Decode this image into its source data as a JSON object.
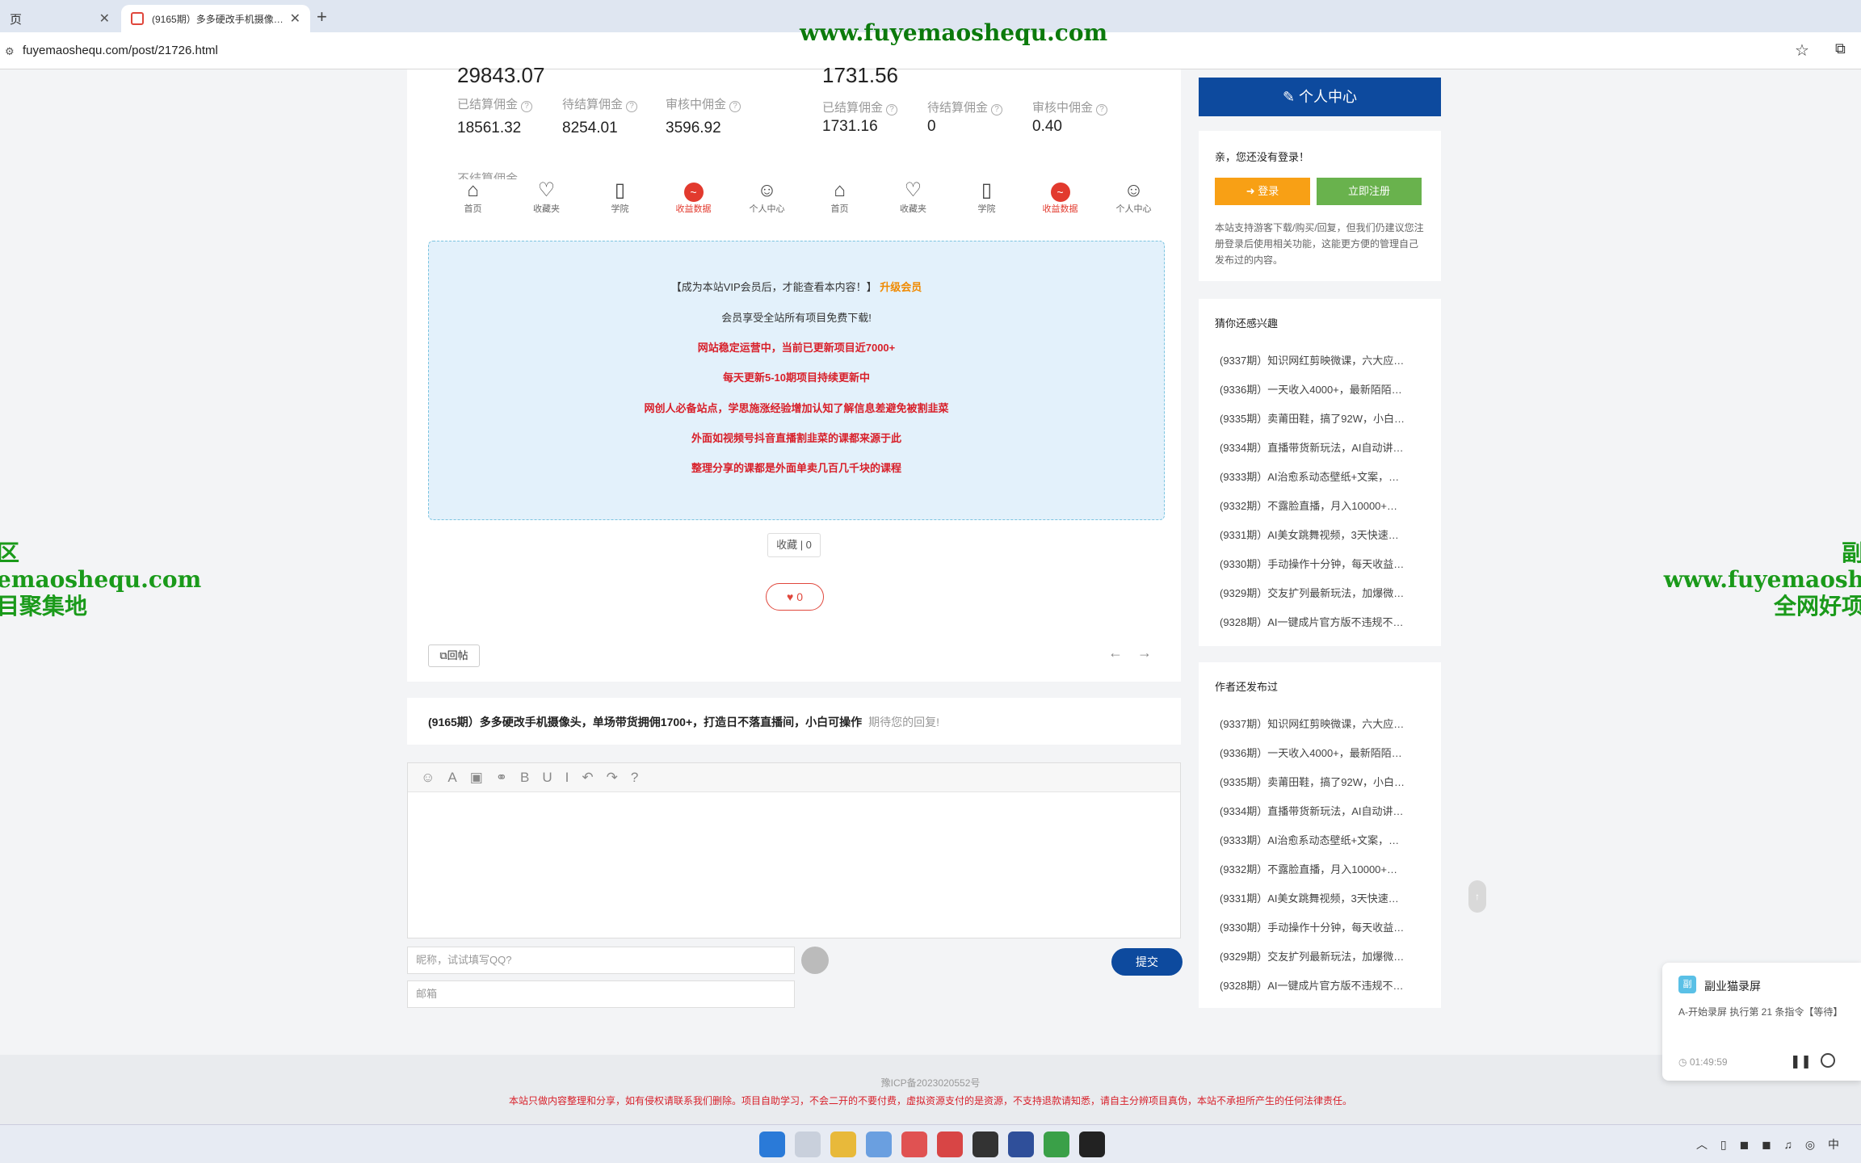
{
  "browser": {
    "tab1_title": "页",
    "tab2_title": "(9165期）多多硬改手机摄像…",
    "url": "fuyemaoshequ.com/post/21726.html"
  },
  "watermark": {
    "top": "www.fuyemaoshequ.com",
    "left": "区\nemaoshequ.com\n目聚集地",
    "right": "副\nwww.fuyemaosh\n全网好项"
  },
  "stats_left": {
    "big": "29843.07",
    "items": [
      {
        "label": "已结算佣金",
        "value": "18561.32"
      },
      {
        "label": "待结算佣金",
        "value": "8254.01"
      },
      {
        "label": "审核中佣金",
        "value": "3596.92"
      }
    ],
    "extra_label": "不结算佣金"
  },
  "stats_right": {
    "big": "1731.56",
    "items": [
      {
        "label": "已结算佣金",
        "value": "1731.16"
      },
      {
        "label": "待结算佣金",
        "value": "0"
      },
      {
        "label": "审核中佣金",
        "value": "0.40"
      }
    ]
  },
  "nav": [
    "首页",
    "收藏夹",
    "学院",
    "收益数据",
    "个人中心"
  ],
  "vip": {
    "line0_prefix": "【成为本站VIP会员后，才能查看本内容！】",
    "line0_link": "升级会员",
    "line1": "会员享受全站所有项目免费下载!",
    "line2": "网站稳定运营中，当前已更新项目近7000+",
    "line3": "每天更新5-10期项目持续更新中",
    "line4": "网创人必备站点，学思施涨经验增加认知了解信息差避免被割韭菜",
    "line5": "外面如视频号抖音直播割韭菜的课都来源于此",
    "line6": "整理分享的课都是外面单卖几百几千块的课程"
  },
  "actions": {
    "collect": "收藏 | 0",
    "like": "0",
    "reply": "回帖"
  },
  "comment": {
    "post_title": "(9165期）多多硬改手机摄像头，单场带货拥佣1700+，打造日不落直播间，小白可操作",
    "hint": "期待您的回复!",
    "nick_placeholder": "昵称，试试填写QQ?",
    "mail_placeholder": "邮箱",
    "submit": "提交"
  },
  "sidebar": {
    "user_center": "个人中心",
    "login_title": "亲，您还没有登录！",
    "login_btn": "登录",
    "register_btn": "立即注册",
    "login_desc": "本站支持游客下载/购买/回复，但我们仍建议您注册登录后使用相关功能，这能更方便的管理自己发布过的内容。",
    "guess_title": "猜你还感兴趣",
    "author_title": "作者还发布过",
    "items": [
      "(9337期）知识网红剪映微课，六大应…",
      "(9336期）一天收入4000+，最新陌陌…",
      "(9335期）卖莆田鞋，搞了92W，小白…",
      "(9334期）直播带货新玩法，AI自动讲…",
      "(9333期）AI治愈系动态壁纸+文案，…",
      "(9332期）不露脸直播，月入10000+…",
      "(9331期）AI美女跳舞视频，3天快速…",
      "(9330期）手动操作十分钟，每天收益…",
      "(9329期）交友扩列最新玩法，加爆微…",
      "(9328期）AI一键成片官方版不违规不…"
    ]
  },
  "footer": {
    "icp": "豫ICP备2023020552号",
    "disclaimer": "本站只做内容整理和分享，如有侵权请联系我们删除。项目自助学习，不会二开的不要付费，虚拟资源支付的是资源，不支持退款请知悉，请自主分辨项目真伪，本站不承担所产生的任何法律责任。"
  },
  "recorder": {
    "name": "副业猫录屏",
    "status": "A-开始录屏 执行第 21 条指令【等待】",
    "time": "01:49:59"
  },
  "tray": {
    "ime": "中"
  }
}
